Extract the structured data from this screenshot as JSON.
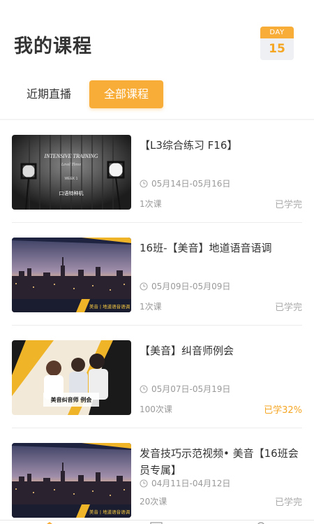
{
  "header": {
    "title": "我的课程",
    "day_label": "DAY",
    "day_value": "15"
  },
  "tabs": [
    {
      "label": "近期直播",
      "active": false
    },
    {
      "label": "全部课程",
      "active": true
    }
  ],
  "colors": {
    "accent": "#f8ad39",
    "accent_text": "#f5a623",
    "muted": "#999999"
  },
  "courses": [
    {
      "title": "【L3综合练习 F16】",
      "date": "05月14日-05月16日",
      "count": "1次课",
      "status": "已学完",
      "thumb_text": {
        "line1": "INTENSIVE TRAINING",
        "line2": "Level Three",
        "line3": "WEEK 1",
        "line4": "口语特种机"
      }
    },
    {
      "title": "16班-【美音】地道语音语调",
      "date": "05月09日-05月09日",
      "count": "1次课",
      "status": "已学完",
      "thumb_text": {
        "line1": "美音 | 地道语音语调"
      }
    },
    {
      "title": "【美音】纠音师例会",
      "date": "05月07日-05月19日",
      "count": "100次课",
      "status": "已学32%",
      "thumb_text": {
        "line1": "美音纠音师 例会"
      }
    },
    {
      "title": "发音技巧示范视频• 美音【16班会员专属】",
      "date": "04月11日-04月12日",
      "count": "20次课",
      "status": "已学完",
      "thumb_text": {
        "line1": "美音 | 地道语音语调"
      }
    }
  ]
}
